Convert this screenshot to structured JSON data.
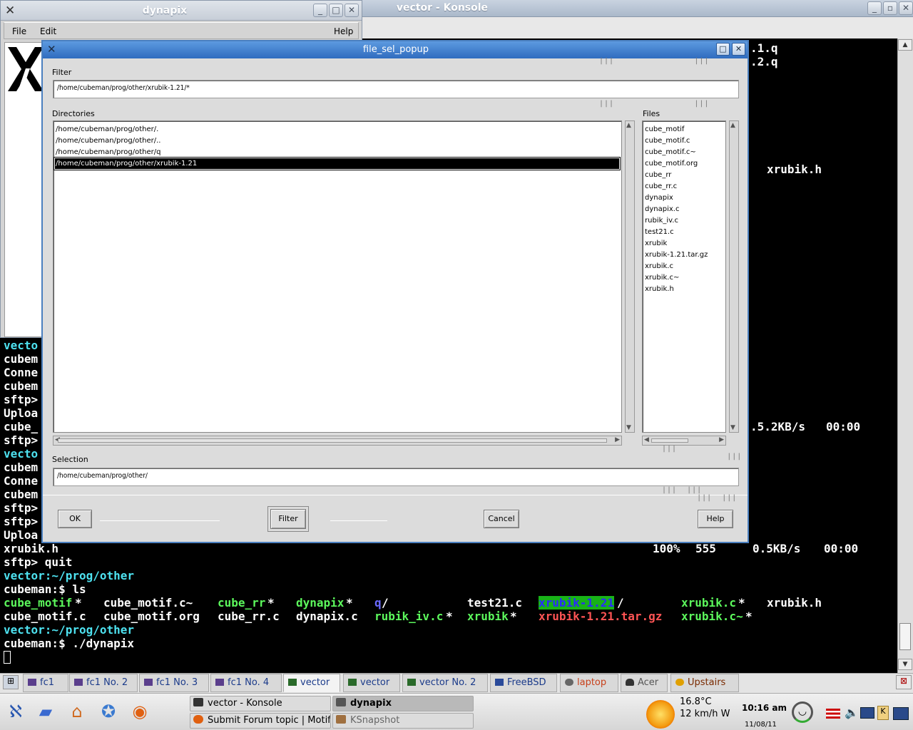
{
  "konsole": {
    "title": "vector - Konsole",
    "right_fragments": [
      ".1.q",
      ".2.q",
      "xrubik.h",
      ".5.2KB/s   00:00"
    ],
    "left_fragments": [
      "vecto",
      "cubem",
      "Conne",
      "cubem",
      "sftp>",
      "Uploa",
      "cube_",
      "sftp>",
      "vecto",
      "cubem",
      "Conne",
      "cubem",
      "sftp>",
      "sftp>",
      "Uploa"
    ],
    "line_upload": {
      "file": "xrubik.h",
      "progress": "100%",
      "size": "555",
      "rate": "0.5KB/s",
      "time": "00:00"
    },
    "line_quit": "sftp> quit",
    "prompt_host": "vector:~/prog/other",
    "prompt_ls": "cubeman:$ ls",
    "ls_row1": [
      "cube_motif",
      "*",
      "cube_motif.c~",
      "cube_rr",
      "*",
      "dynapix",
      "*",
      "q",
      "/",
      "test21.c",
      "xrubik-1.21",
      "/",
      "xrubik.c",
      "*",
      "xrubik.h"
    ],
    "ls_row2": [
      "cube_motif.c",
      "cube_motif.org",
      "cube_rr.c",
      "dynapix.c",
      "rubik_iv.c",
      "*",
      "xrubik",
      "*",
      "xrubik-1.21.tar.gz",
      "xrubik.c~",
      "*"
    ],
    "prompt_host2": "vector:~/prog/other",
    "prompt_run": "cubeman:$ ./dynapix"
  },
  "dynapix": {
    "title": "dynapix",
    "menu": {
      "file": "File",
      "edit": "Edit",
      "help": "Help"
    }
  },
  "file_sel_popup": {
    "title": "file_sel_popup",
    "filter_label": "Filter",
    "filter_value": "/home/cubeman/prog/other/xrubik-1.21/*",
    "directories_label": "Directories",
    "directories": [
      "/home/cubeman/prog/other/.",
      "/home/cubeman/prog/other/..",
      "/home/cubeman/prog/other/q",
      "/home/cubeman/prog/other/xrubik-1.21"
    ],
    "files_label": "Files",
    "files": [
      "cube_motif",
      "cube_motif.c",
      "cube_motif.c~",
      "cube_motif.org",
      "cube_rr",
      "cube_rr.c",
      "dynapix",
      "dynapix.c",
      "rubik_iv.c",
      "test21.c",
      "xrubik",
      "xrubik-1.21.tar.gz",
      "xrubik.c",
      "xrubik.c~",
      "xrubik.h"
    ],
    "selection_label": "Selection",
    "selection_value": "/home/cubeman/prog/other/",
    "buttons": {
      "ok": "OK",
      "filter": "Filter",
      "cancel": "Cancel",
      "help": "Help"
    }
  },
  "taskbar": {
    "tabs": [
      "fc1",
      "fc1 No. 2",
      "fc1 No. 3",
      "fc1 No. 4",
      "vector",
      "vector",
      "vector No. 2",
      "FreeBSD",
      "laptop",
      "Acer",
      "Upstairs"
    ],
    "tasks": [
      "vector - Konsole",
      "dynapix",
      "Submit Forum topic | Motif",
      "KSnapshot"
    ],
    "weather": {
      "temp": "16.8°C",
      "wind": "12 km/h W"
    },
    "clock": {
      "time": "10:16 am",
      "date": "11/08/11"
    }
  }
}
